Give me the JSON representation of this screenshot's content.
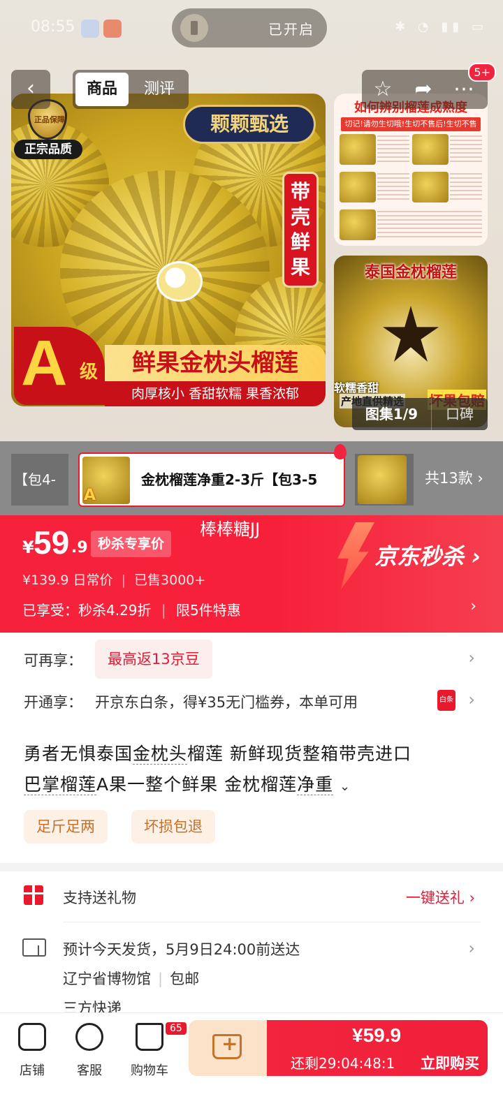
{
  "status_bar": {
    "time": "08:55",
    "flashlight_text": "已开启"
  },
  "header": {
    "tabs": [
      {
        "label": "商品",
        "active": true
      },
      {
        "label": "测评",
        "active": false
      }
    ],
    "notification_badge": "5+"
  },
  "gallery": {
    "main_image": {
      "banner_top": "颗颗甄选",
      "cert_label": "正宗品质",
      "cert_seal": "正品保障",
      "vertical_tag": "带壳鲜果",
      "grade_letter": "A",
      "grade_suffix": "级",
      "title": "鲜果金枕头榴莲",
      "subtitle": "肉厚核小 香甜软糯 果香浓郁"
    },
    "side_image_1": {
      "heading": "如何辨别榴莲成熟度",
      "warning": "切记!请勿生切哦!生切不售后!生切不售后!"
    },
    "side_image_2": {
      "heading": "泰国金枕榴莲",
      "badge_1": "软糯香甜",
      "badge_2": "产地直供精选",
      "badge_3": "坏果包赔"
    },
    "pager": "图集1/9",
    "reviews_tab": "口碑"
  },
  "variants": {
    "prev_label": "【包4-",
    "selected_label": "金枕榴莲净重2-3斤【包3-5",
    "total": "共13款"
  },
  "price_block": {
    "currency": "¥",
    "price_int": "59",
    "price_dec": ".9",
    "tag": "秒杀专享价",
    "watermark": "棒棒糖JJ",
    "brand": "京东秒杀",
    "daily_price": "¥139.9",
    "daily_label": "日常价",
    "sold": "已售3000+",
    "enjoy": "已享受：秒杀4.29折",
    "limit": "限5件特惠"
  },
  "promotions": {
    "row1_label": "可再享：",
    "row1_tag": "最高返13京豆",
    "row2_label": "开通享：",
    "row2_text": "开京东白条，得¥35无门槛券，本单可用",
    "baitiao_icon_text": "白条"
  },
  "product": {
    "title_parts": [
      "勇者无惧泰国",
      "金枕头",
      "榴莲 新鲜现货整箱带壳进口",
      "巴掌榴莲",
      "A果一整个鲜果 金枕榴莲",
      "净重"
    ],
    "chips": [
      "足斤足两",
      "坏损包退"
    ]
  },
  "service": {
    "gift_text": "支持送礼物",
    "gift_action": "一键送礼",
    "ship_line1": "预计今天发货，5月9日24:00前送达",
    "ship_location": "辽宁省博物馆",
    "ship_free": "包邮",
    "ship_line3": "三方快递"
  },
  "bottom_bar": {
    "store": "店铺",
    "service": "客服",
    "cart": "购物车",
    "cart_badge": "65",
    "buy_price": "¥59.9",
    "countdown": "还剩29:04:48:1",
    "buy_label": "立即购买"
  },
  "colors": {
    "accent_red": "#f2253d",
    "promo_red": "#e21d36",
    "chip_text": "#c8702a"
  }
}
